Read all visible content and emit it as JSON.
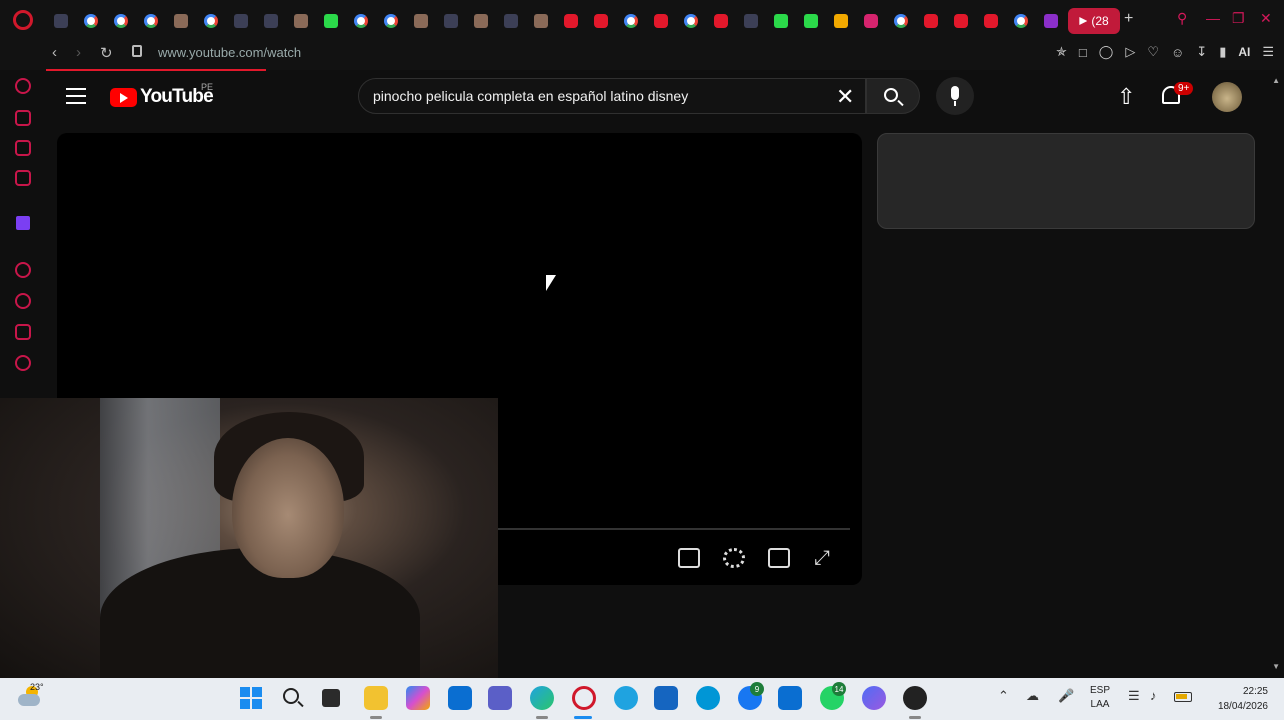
{
  "browser": {
    "active_tab_label": "(28",
    "new_tab_symbol": "+",
    "url": "www.youtube.com/watch",
    "ai_label": "AI"
  },
  "youtube": {
    "logo_text": "YouTube",
    "country_code": "PE",
    "search_query": "pinocho pelicula completa en español latino disney",
    "notifications_badge": "9+"
  },
  "taskbar": {
    "temperature": "23°",
    "language_top": "ESP",
    "language_bottom": "LAA",
    "time": "22:25",
    "date": "18/04/2026",
    "facebook_badge": "9",
    "whatsapp_badge": "14"
  },
  "colors": {
    "opera_red": "#d0182b",
    "youtube_red": "#ff0000",
    "page_bg": "#0f0f0f"
  }
}
